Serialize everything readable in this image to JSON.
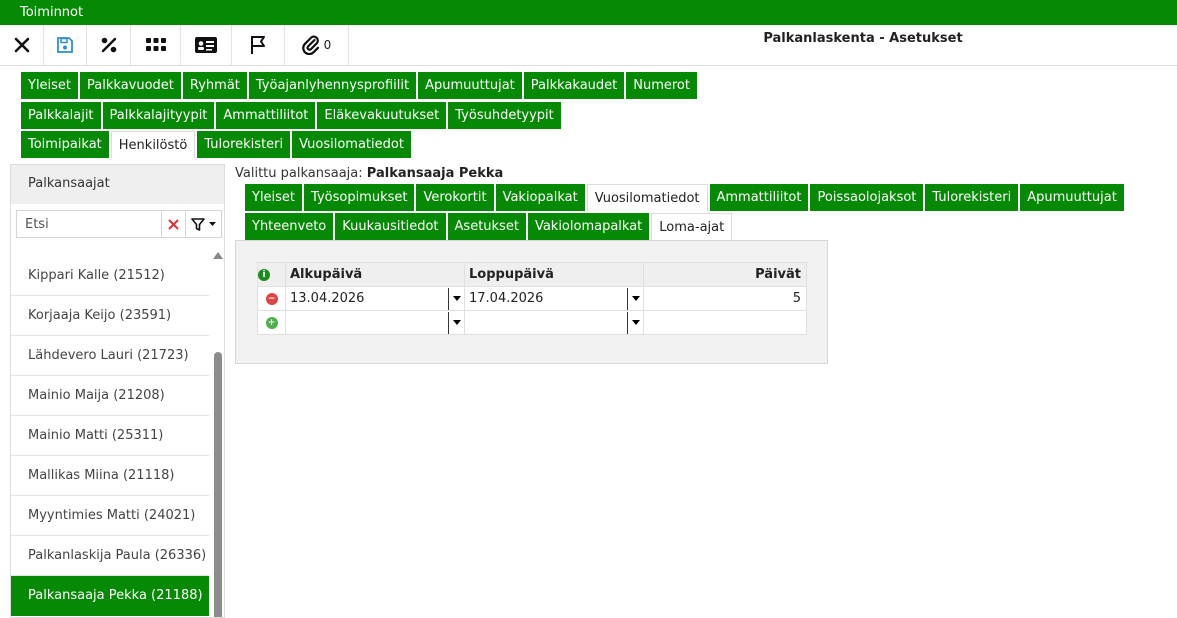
{
  "topbar": {
    "title": "Toiminnot"
  },
  "toolbar": {
    "page_title": "Palkanlaskenta - Asetukset",
    "attachment_count": "0",
    "buttons": [
      "close-icon",
      "save-icon",
      "percent-icon",
      "grid-icon",
      "id-card-icon",
      "flag-icon",
      "paperclip-icon"
    ]
  },
  "main_tabs": {
    "row1": [
      "Yleiset",
      "Palkkavuodet",
      "Ryhmät",
      "Työajanlyhennysprofiilit",
      "Apumuuttujat",
      "Palkkakaudet",
      "Numerot"
    ],
    "row2": [
      "Palkkalajit",
      "Palkkalajityypit",
      "Ammattiliitot",
      "Eläkevakuutukset",
      "Työsuhdetyypit"
    ],
    "row3": [
      "Toimipaikat",
      "Henkilöstö",
      "Tulorekisteri",
      "Vuosilomatiedot"
    ],
    "active": "Henkilöstö"
  },
  "sidebar": {
    "header": "Palkansaajat",
    "search_placeholder": "Etsi",
    "items": [
      "Kippari Kalle (21512)",
      "Korjaaja Keijo (23591)",
      "Lähdevero Lauri (21723)",
      "Mainio Maija (21208)",
      "Mainio Matti (25311)",
      "Mallikas Miina (21118)",
      "Myyntimies Matti (24021)",
      "Palkanlaskija Paula (26336)",
      "Palkansaaja Pekka (21188)"
    ],
    "selected": "Palkansaaja Pekka (21188)"
  },
  "employee": {
    "label": "Valittu palkansaaja:",
    "name": "Palkansaaja Pekka"
  },
  "sub_tabs": {
    "row1": [
      "Yleiset",
      "Työsopimukset",
      "Verokortit",
      "Vakiopalkat",
      "Vuosilomatiedot",
      "Ammattiliitot",
      "Poissaolojaksot",
      "Tulorekisteri",
      "Apumuuttujat"
    ],
    "row2": [
      "Yhteenveto",
      "Kuukausitiedot",
      "Asetukset",
      "Vakiolomapalkat",
      "Loma-ajat"
    ],
    "active_row1": "Vuosilomatiedot",
    "active_row2": "Loma-ajat"
  },
  "grid": {
    "columns": [
      "Alkupäivä",
      "Loppupäivä",
      "Päivät"
    ],
    "rows": [
      {
        "start": "13.04.2026",
        "end": "17.04.2026",
        "days": "5"
      }
    ]
  },
  "colors": {
    "brand_green": "#068a06",
    "remove_red": "#e04545",
    "add_green": "#4cb04c"
  }
}
